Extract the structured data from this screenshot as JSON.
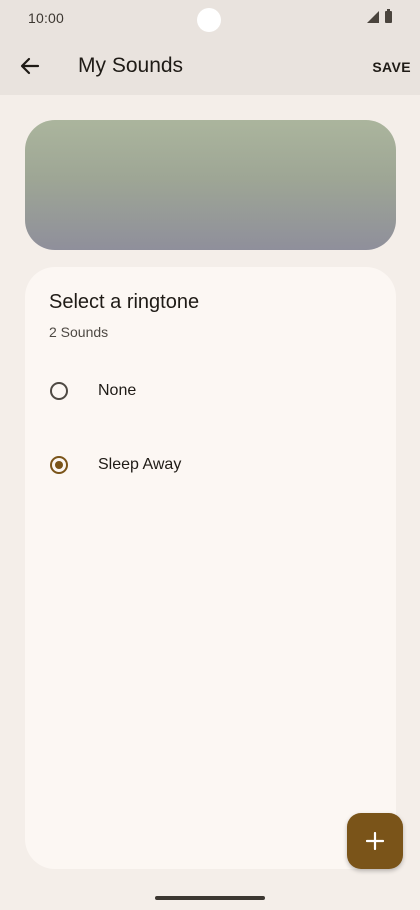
{
  "status_bar": {
    "time": "10:00",
    "icons": [
      "signal-icon",
      "battery-icon"
    ]
  },
  "app_bar": {
    "back_icon": "arrow-back-icon",
    "title": "My Sounds",
    "save_label": "SAVE"
  },
  "card": {
    "title": "Select a ringtone",
    "subtitle": "2 Sounds",
    "options": [
      {
        "label": "None",
        "selected": false
      },
      {
        "label": "Sleep Away",
        "selected": true
      }
    ]
  },
  "fab": {
    "icon": "add-icon"
  },
  "colors": {
    "background": "#f4eee9",
    "app_bar": "#e9e3de",
    "card": "#fcf7f3",
    "accent": "#7a5419",
    "text": "#1f1b16"
  }
}
